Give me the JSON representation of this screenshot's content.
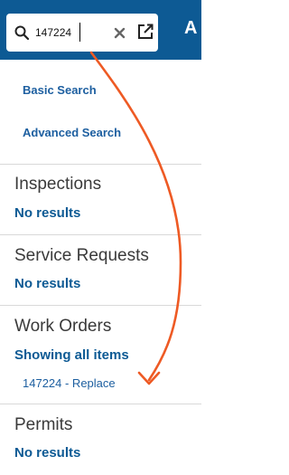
{
  "search": {
    "value": "147224"
  },
  "topbar": {
    "letter": "A"
  },
  "links": {
    "basic": "Basic Search",
    "advanced": "Advanced Search"
  },
  "sections": [
    {
      "title": "Inspections",
      "status": "No results"
    },
    {
      "title": "Service Requests",
      "status": "No results"
    },
    {
      "title": "Work Orders",
      "status": "Showing all items",
      "results": [
        "147224 - Replace"
      ]
    },
    {
      "title": "Permits",
      "status": "No results"
    }
  ],
  "colors": {
    "brand": "#0d5a94",
    "link": "#1d5fa0",
    "annotation_arrow": "#ee5a24"
  }
}
